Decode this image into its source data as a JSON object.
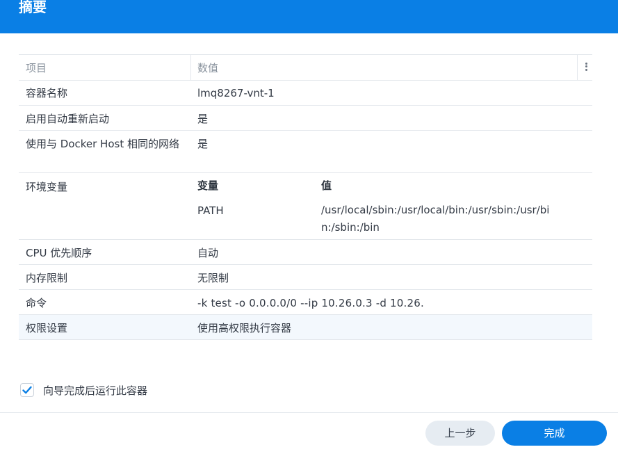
{
  "header": {
    "title": "摘要"
  },
  "table": {
    "headers": {
      "item": "项目",
      "value": "数值"
    },
    "rows": {
      "container_name": {
        "key": "容器名称",
        "value": "lmq8267-vnt-1"
      },
      "auto_restart": {
        "key": "启用自动重新启动",
        "value": "是"
      },
      "host_network": {
        "key": "使用与 Docker Host 相同的网络",
        "value": "是"
      },
      "env": {
        "key": "环境变量",
        "col_var": "变量",
        "col_val": "值",
        "vars": [
          {
            "name": "PATH",
            "value": "/usr/local/sbin:/usr/local/bin:/usr/sbin:/usr/bin:/sbin:/bin"
          }
        ]
      },
      "cpu_priority": {
        "key": "CPU 优先顺序",
        "value": "自动"
      },
      "memory_limit": {
        "key": "内存限制",
        "value": "无限制"
      },
      "command": {
        "key": "命令",
        "value": "-k test -o 0.0.0.0/0 --ip 10.26.0.3 -d 10.26."
      },
      "privilege": {
        "key": "权限设置",
        "value": "使用高权限执行容器"
      }
    }
  },
  "options": {
    "run_after_wizard": {
      "label": "向导完成后运行此容器",
      "checked": true
    }
  },
  "footer": {
    "prev_label": "上一步",
    "done_label": "完成"
  },
  "colors": {
    "accent": "#0a7fe5",
    "highlight_row": "#f3f8fd"
  },
  "icons": {
    "check": "check-icon",
    "more": "more-vertical-icon"
  }
}
